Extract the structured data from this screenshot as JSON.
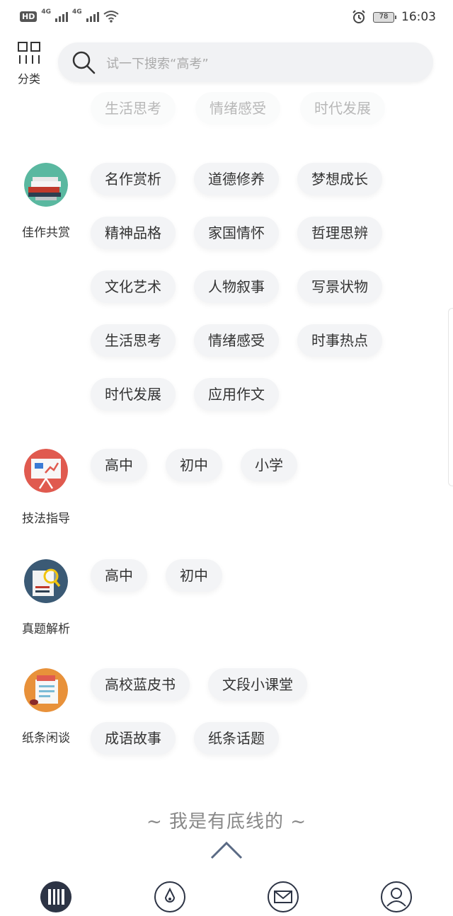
{
  "status_bar": {
    "hd_badge": "HD",
    "hd_sub": "1",
    "net1": "4G",
    "net2": "4G",
    "battery": "78",
    "time": "16:03"
  },
  "header": {
    "category_label": "分类",
    "search_placeholder": "试一下搜索“高考”"
  },
  "faded_row": [
    "生活思考",
    "情绪感受",
    "时代发展"
  ],
  "sections": [
    {
      "label": "佳作共赏",
      "icon": "books-icon",
      "rows": [
        [
          "名作赏析",
          "道德修养",
          "梦想成长"
        ],
        [
          "精神品格",
          "家国情怀",
          "哲理思辨"
        ],
        [
          "文化艺术",
          "人物叙事",
          "写景状物"
        ],
        [
          "生活思考",
          "情绪感受",
          "时事热点"
        ],
        [
          "时代发展",
          "应用作文"
        ]
      ]
    },
    {
      "label": "技法指导",
      "icon": "presentation-board-icon",
      "rows": [
        [
          "高中",
          "初中",
          "小学"
        ]
      ]
    },
    {
      "label": "真题解析",
      "icon": "magnifier-document-icon",
      "rows": [
        [
          "高中",
          "初中"
        ]
      ]
    },
    {
      "label": "纸条闲谈",
      "icon": "notes-icon",
      "rows": [
        [
          "高校蓝皮书",
          "文段小课堂"
        ],
        [
          "成语故事",
          "纸条话题"
        ]
      ]
    }
  ],
  "footer_text": "~ 我是有底线的 ~",
  "nav": {
    "items": [
      "library-icon",
      "ink-drop-icon",
      "mail-icon",
      "profile-icon"
    ]
  },
  "colors": {
    "tag_bg": "#f3f4f6",
    "nav_accent": "#2d3445",
    "chevron": "#5a6a84"
  }
}
